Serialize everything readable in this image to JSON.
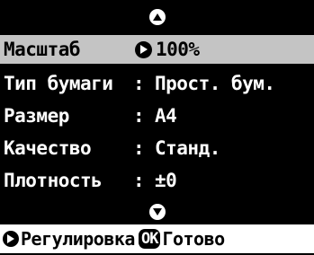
{
  "menu": {
    "scale": {
      "label": "Масштаб",
      "value": "100%"
    },
    "paper_type": {
      "label": "Тип бумаги",
      "colon": ":",
      "value": "Прост. бум."
    },
    "size": {
      "label": "Размер",
      "colon": ":",
      "value": "A4"
    },
    "quality": {
      "label": "Качество",
      "colon": ":",
      "value": "Станд."
    },
    "density": {
      "label": "Плотность",
      "colon": ":",
      "value": "±0"
    }
  },
  "footer": {
    "adjust_label": "Регулировка",
    "ok_key": "OK",
    "done_label": "Готово"
  },
  "icons": {
    "scroll_up": "up-arrow-icon",
    "scroll_down": "down-arrow-icon",
    "value_selector": "right-arrow-icon",
    "adjust_key": "right-arrow-icon"
  },
  "colors": {
    "screen_background": "#000000",
    "highlight": "#c4c4c4",
    "footer_background": "#ffffff"
  }
}
